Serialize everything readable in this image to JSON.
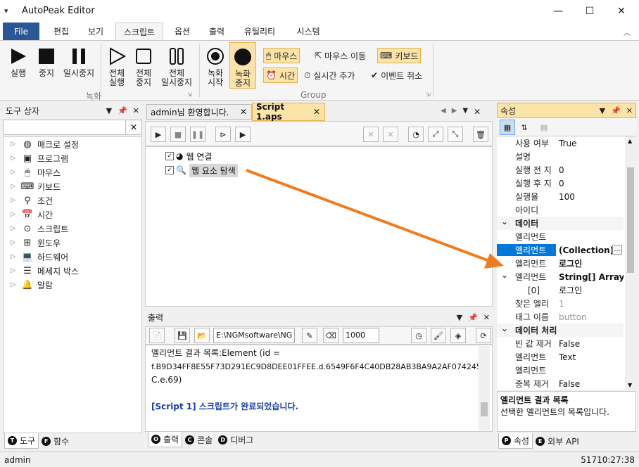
{
  "window": {
    "title": "AutoPeak Editor",
    "menu_icon": "▾",
    "minimize": "—",
    "maximize": "☐",
    "close": "✕"
  },
  "menu_tabs": [
    "File",
    "편집",
    "보기",
    "스크립트",
    "옵션",
    "출력",
    "유틸리티",
    "시스템"
  ],
  "ribbon": {
    "run": "실행",
    "stop": "중지",
    "pause": "일시중지",
    "all_run": [
      "전체",
      "실행"
    ],
    "all_stop": [
      "전체",
      "중지"
    ],
    "all_pause": [
      "전체",
      "일시중지"
    ],
    "rec_start": [
      "녹화",
      "시작"
    ],
    "rec_stop": [
      "녹화",
      "중지"
    ],
    "mouse": "마우스",
    "mouse_move": "마우스 이동",
    "keyboard": "키보드",
    "time": "시간",
    "add_realtime": "실시간 추가",
    "cancel_event": "이벤트 취소",
    "group_record": "녹화",
    "group_group": "Group"
  },
  "toolbox": {
    "title": "도구 상자",
    "items": [
      "매크로 설정",
      "프로그램",
      "마우스",
      "키보드",
      "조건",
      "시간",
      "스크립트",
      "윈도우",
      "하드웨어",
      "메세지 박스",
      "알람"
    ],
    "tabs": [
      "도구",
      "함수"
    ],
    "tab_letters": [
      "T",
      "F"
    ]
  },
  "editor": {
    "tabs": [
      "admin님 환영합니다.",
      "Script 1.aps"
    ],
    "nodes": [
      "웹 연결",
      "웹 요소 탐색"
    ]
  },
  "output": {
    "title": "출력",
    "path": "E:\\NGMsoftware\\NG",
    "number": "1000",
    "line1": "엘리먼트 결과 목록:Element (id =",
    "line2": "f.B9D34FF8E55F73D291EC9D8DEE01FFEE.d.6549F6F4C40DB28AB3BA9A2AF074245",
    "line3": "C.e.69)",
    "line4": "[Script 1] 스크립트가 완료되었습니다.",
    "tabs": [
      "출력",
      "콘솔",
      "디버그"
    ],
    "tab_letters": [
      "O",
      "C",
      "D"
    ]
  },
  "props": {
    "title": "속성",
    "rows": [
      {
        "k": "사용 여부",
        "v": "True",
        "t": "row"
      },
      {
        "k": "설명",
        "v": "",
        "t": "row"
      },
      {
        "k": "실행 전 지",
        "v": "0",
        "t": "row"
      },
      {
        "k": "실행 후 지",
        "v": "0",
        "t": "row"
      },
      {
        "k": "실행율",
        "v": "100",
        "t": "row"
      },
      {
        "k": "아이디",
        "v": "",
        "t": "row"
      },
      {
        "k": "데이터",
        "v": "",
        "t": "cat"
      },
      {
        "k": "엘리먼트",
        "v": "",
        "t": "row"
      },
      {
        "k": "엘리먼트",
        "v": "(Collection)",
        "t": "sel"
      },
      {
        "k": "엘리먼트",
        "v": "로그인",
        "t": "bold"
      },
      {
        "k": "엘리먼트",
        "v": "String[] Array",
        "t": "boldexp"
      },
      {
        "k": "[0]",
        "v": "로그인",
        "t": "sub"
      },
      {
        "k": "찾은 엘리",
        "v": "1",
        "t": "dis"
      },
      {
        "k": "태그 이름",
        "v": "button",
        "t": "dis"
      },
      {
        "k": "데이터 처리",
        "v": "",
        "t": "cat"
      },
      {
        "k": "빈 값 제거",
        "v": "False",
        "t": "row"
      },
      {
        "k": "엘리먼트",
        "v": "Text",
        "t": "row"
      },
      {
        "k": "엘리먼트",
        "v": "",
        "t": "row"
      },
      {
        "k": "중복 제거",
        "v": "False",
        "t": "row"
      }
    ],
    "desc_title": "엘리먼트 결과 목록",
    "desc_text": "선택한 엘리먼트의 목록입니다.",
    "tabs": [
      "속성",
      "외부 API"
    ],
    "tab_letters": [
      "P",
      "E"
    ]
  },
  "status": {
    "user": "admin",
    "time": "51710:27:38"
  },
  "colors": {
    "accent": "#2b5797",
    "arrow": "#f07c22",
    "highlight": "#fce4a8",
    "selection": "#0078d7"
  }
}
